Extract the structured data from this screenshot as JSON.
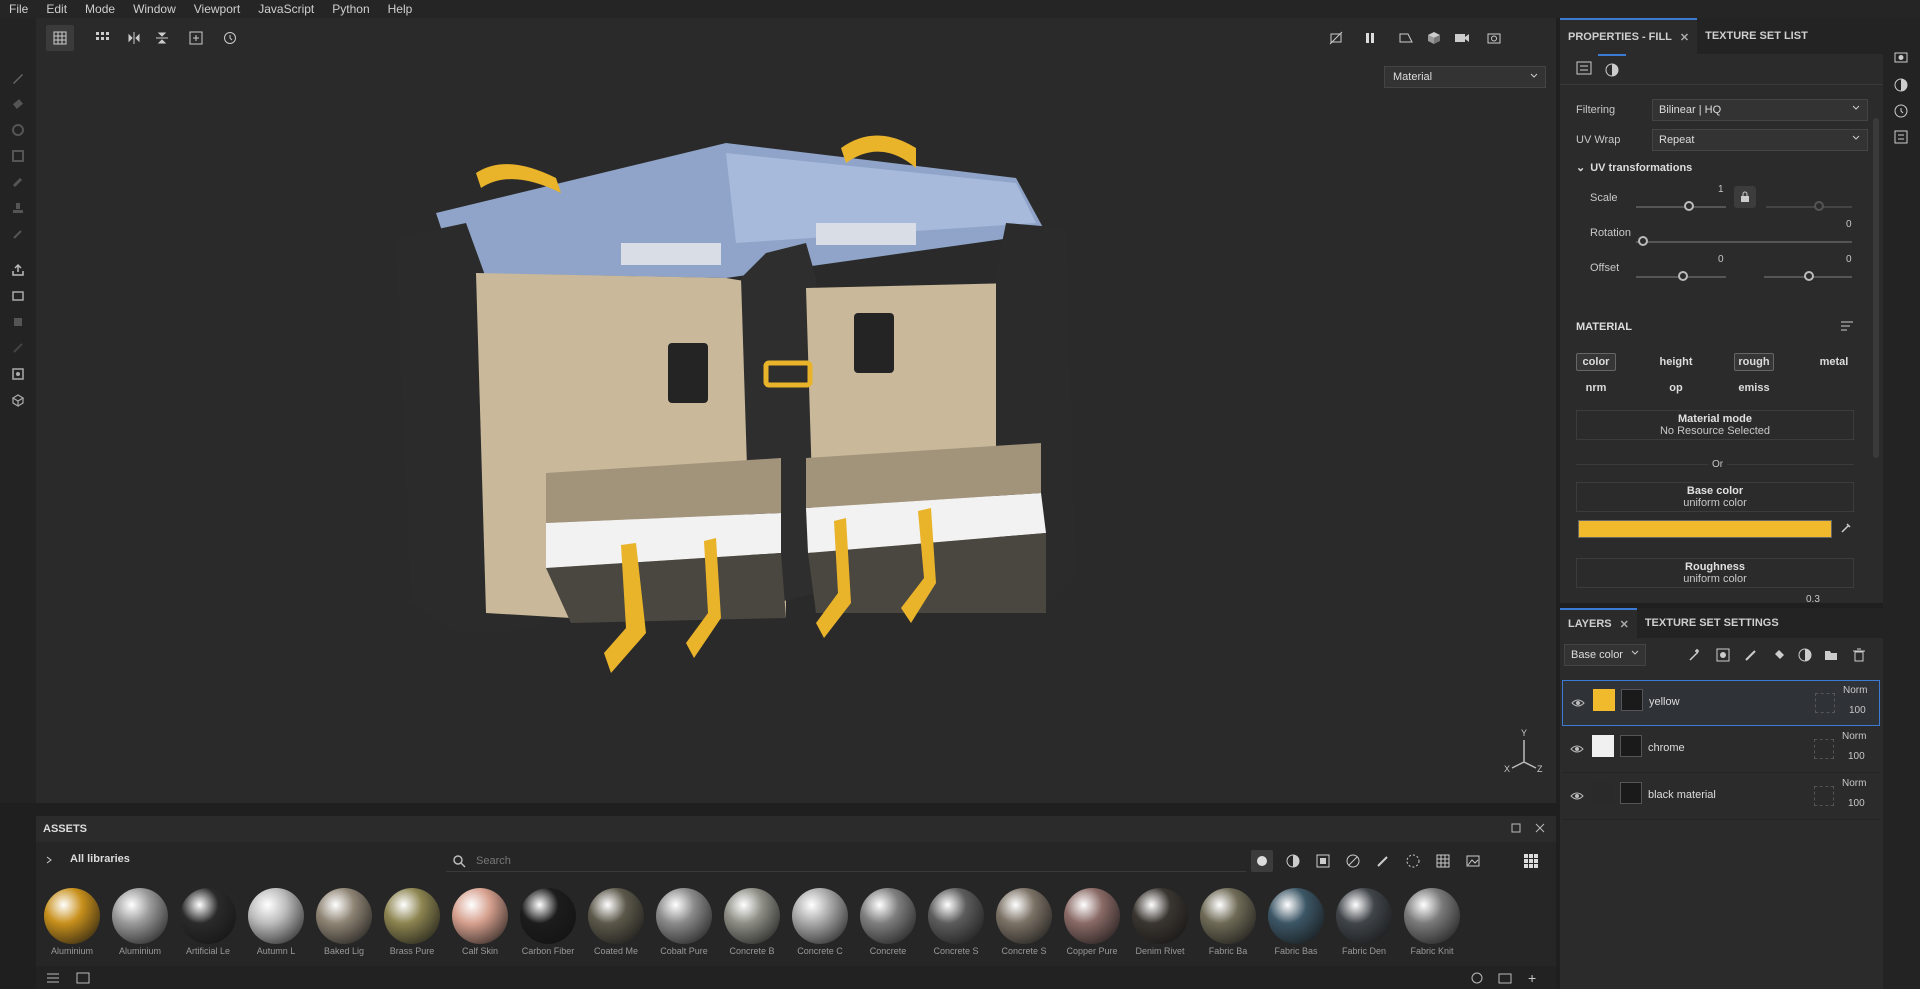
{
  "menu": [
    "File",
    "Edit",
    "Mode",
    "Window",
    "Viewport",
    "JavaScript",
    "Python",
    "Help"
  ],
  "viewport": {
    "mode_select": "Material",
    "axis_x": "X",
    "axis_y": "Y",
    "axis_z": "Z"
  },
  "properties": {
    "tab_active": "PROPERTIES - FILL",
    "tab_other": "TEXTURE SET LIST",
    "filtering_label": "Filtering",
    "filtering_value": "Bilinear | HQ",
    "uvwrap_label": "UV Wrap",
    "uvwrap_value": "Repeat",
    "uv_section": "UV transformations",
    "scale_label": "Scale",
    "scale_value": "1",
    "rotation_label": "Rotation",
    "rotation_value": "0",
    "offset_label": "Offset",
    "offset_x": "0",
    "offset_y": "0",
    "material_header": "MATERIAL",
    "channels": [
      "color",
      "height",
      "rough",
      "metal",
      "nrm",
      "op",
      "emiss"
    ],
    "material_mode_title": "Material mode",
    "material_mode_value": "No Resource Selected",
    "or_label": "Or",
    "base_color_title": "Base color",
    "base_color_sub": "uniform color",
    "base_color_hex": "#f1b92c",
    "roughness_title": "Roughness",
    "roughness_sub": "uniform color",
    "roughness_value": "0.3"
  },
  "layers_panel": {
    "tab_active": "LAYERS",
    "tab_other": "TEXTURE SET SETTINGS",
    "channel_select": "Base color",
    "items": [
      {
        "name": "yellow",
        "blend": "Norm",
        "opacity": "100"
      },
      {
        "name": "chrome",
        "blend": "Norm",
        "opacity": "100"
      },
      {
        "name": "black material",
        "blend": "Norm",
        "opacity": "100"
      }
    ]
  },
  "assets": {
    "title": "ASSETS",
    "library": "All libraries",
    "search_placeholder": "Search",
    "items": [
      {
        "label": "Aluminium",
        "color": "#c8901c"
      },
      {
        "label": "Aluminium",
        "color": "#9a9a9a"
      },
      {
        "label": "Artificial Le",
        "color": "#2a2a2a"
      },
      {
        "label": "Autumn L",
        "color": "#bcbcbc"
      },
      {
        "label": "Baked Lig",
        "color": "#8e8474"
      },
      {
        "label": "Brass Pure",
        "color": "#8c8450"
      },
      {
        "label": "Calf Skin",
        "color": "#d6a08e"
      },
      {
        "label": "Carbon Fiber",
        "color": "#1c1c1c"
      },
      {
        "label": "Coated Me",
        "color": "#5c584a"
      },
      {
        "label": "Cobalt Pure",
        "color": "#8a8a8a"
      },
      {
        "label": "Concrete B",
        "color": "#8e8e86"
      },
      {
        "label": "Concrete C",
        "color": "#a9a9a9"
      },
      {
        "label": "Concrete",
        "color": "#7e7e7e"
      },
      {
        "label": "Concrete S",
        "color": "#5c5c5c"
      },
      {
        "label": "Concrete S",
        "color": "#7c7266"
      },
      {
        "label": "Copper Pure",
        "color": "#8a6a66"
      },
      {
        "label": "Denim Rivet",
        "color": "#3a3530"
      },
      {
        "label": "Fabric Ba",
        "color": "#6e6a56"
      },
      {
        "label": "Fabric Bas",
        "color": "#3c5666"
      },
      {
        "label": "Fabric Den",
        "color": "#40454a"
      },
      {
        "label": "Fabric Knit",
        "color": "#7a7a7a"
      }
    ]
  }
}
